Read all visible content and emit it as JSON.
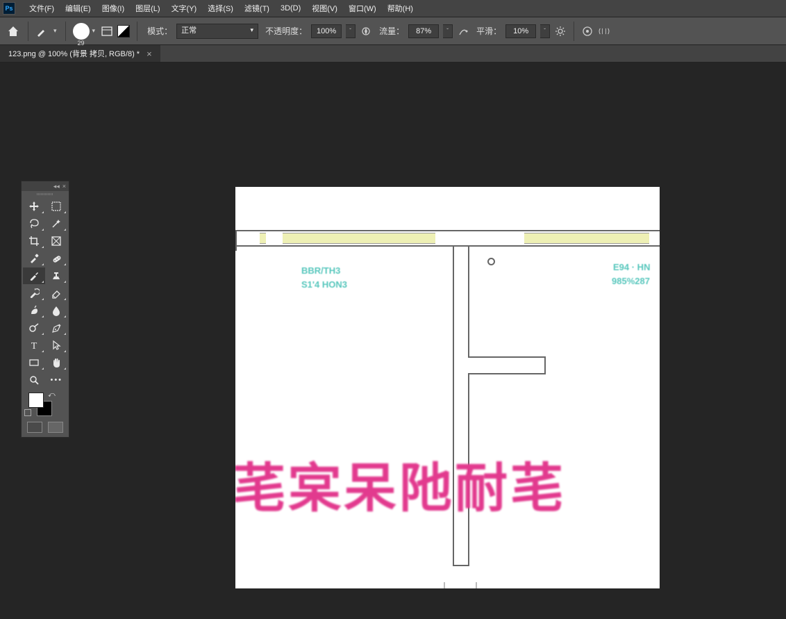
{
  "app": {
    "logo_text": "Ps"
  },
  "menu": {
    "items": [
      "文件(F)",
      "编辑(E)",
      "图像(I)",
      "图层(L)",
      "文字(Y)",
      "选择(S)",
      "滤镜(T)",
      "3D(D)",
      "视图(V)",
      "窗口(W)",
      "帮助(H)"
    ]
  },
  "options": {
    "brush_size": "29",
    "mode_label": "模式：",
    "mode_value": "正常",
    "opacity_label": "不透明度：",
    "opacity_value": "100%",
    "flow_label": "流量：",
    "flow_value": "87%",
    "smoothing_label": "平滑：",
    "smoothing_value": "10%"
  },
  "tab": {
    "title": "123.png @ 100% (背景 拷贝, RGB/8) *"
  },
  "tools": {
    "names": [
      "move-tool",
      "marquee-tool",
      "lasso-tool",
      "magic-wand-tool",
      "crop-tool",
      "frame-tool",
      "eyedropper-tool",
      "spot-healing-tool",
      "brush-tool",
      "clone-stamp-tool",
      "history-brush-tool",
      "eraser-tool",
      "gradient-tool",
      "blur-tool",
      "dodge-tool",
      "pen-tool",
      "type-tool",
      "path-selection-tool",
      "rectangle-tool",
      "hand-tool",
      "zoom-tool",
      "edit-toolbar"
    ]
  },
  "canvas_content": {
    "text_left_1": "BBR/TH3",
    "text_left_2": "S1'4 HON3",
    "text_right_1": "E94 · HN",
    "text_right_2": "985%287",
    "pink_text": "芼宲呆阤耐芼"
  }
}
